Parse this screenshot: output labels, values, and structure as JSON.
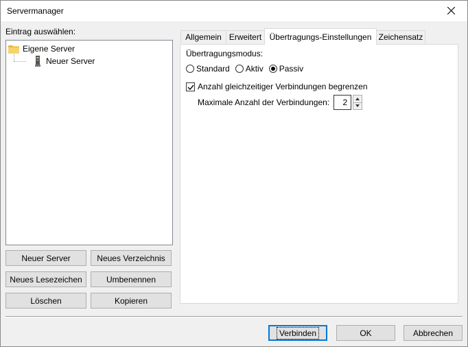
{
  "window": {
    "title": "Servermanager"
  },
  "left": {
    "select_label": "Eintrag auswählen:",
    "tree": {
      "root": "Eigene Server",
      "child": "Neuer Server"
    },
    "buttons": {
      "new_server": "Neuer Server",
      "new_directory": "Neues Verzeichnis",
      "new_bookmark": "Neues Lesezeichen",
      "rename": "Umbenennen",
      "delete": "Löschen",
      "copy": "Kopieren"
    }
  },
  "tabs": [
    {
      "label": "Allgemein"
    },
    {
      "label": "Erweitert"
    },
    {
      "label": "Übertragungs-Einstellungen"
    },
    {
      "label": "Zeichensatz"
    }
  ],
  "transfer": {
    "mode_label": "Übertragungsmodus:",
    "modes": [
      "Standard",
      "Aktiv",
      "Passiv"
    ],
    "selected_mode": "Passiv",
    "limit_label": "Anzahl gleichzeitiger Verbindungen begrenzen",
    "limit_checked": true,
    "max_label": "Maximale Anzahl der Verbindungen:",
    "max_value": "2"
  },
  "footer": {
    "connect": "Verbinden",
    "ok": "OK",
    "cancel": "Abbrechen"
  }
}
